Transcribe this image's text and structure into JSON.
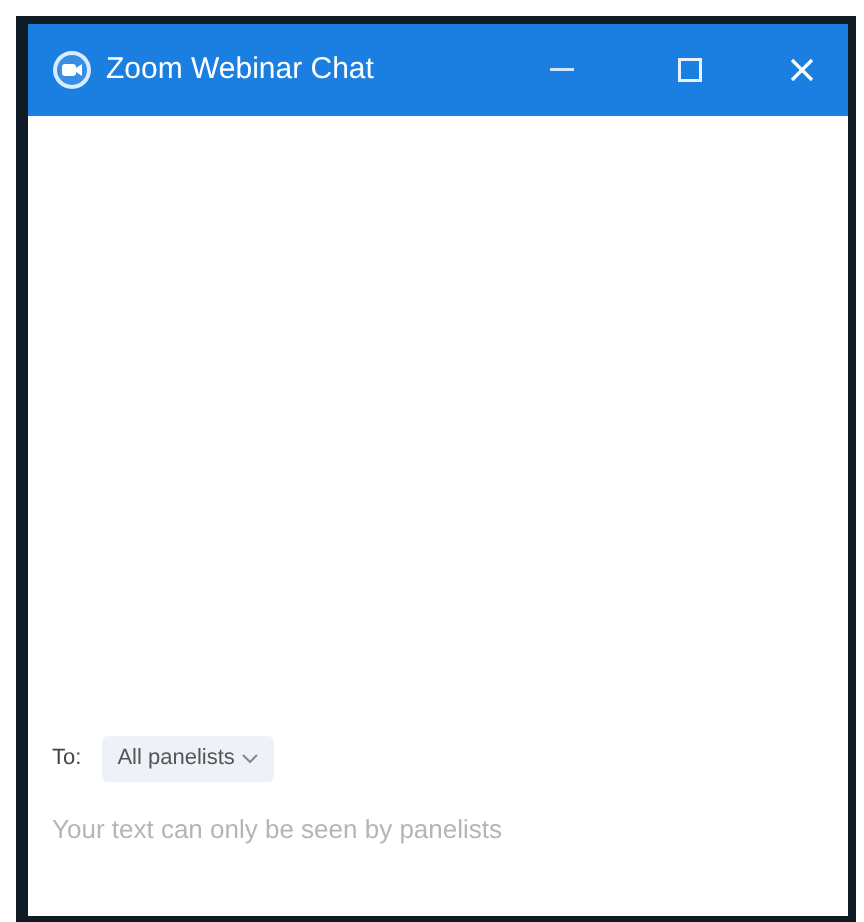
{
  "window": {
    "title": "Zoom Webinar Chat"
  },
  "chat": {
    "to_label": "To:",
    "recipient": "All panelists",
    "input": {
      "placeholder": "Your text can only be seen by panelists"
    }
  }
}
